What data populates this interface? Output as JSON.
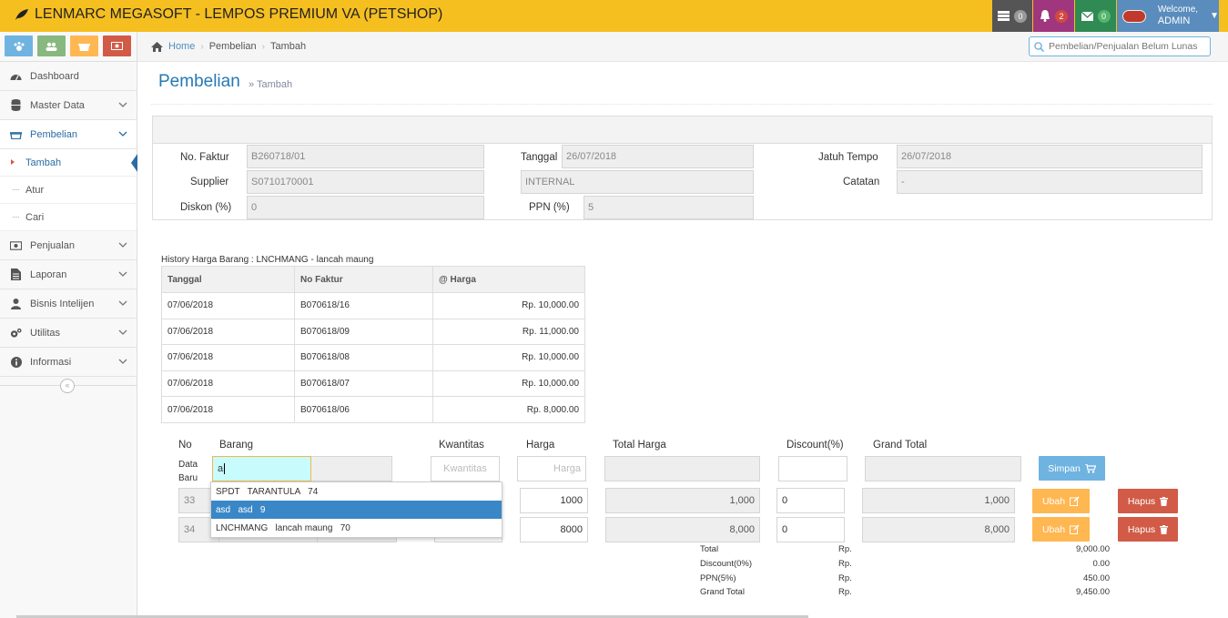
{
  "app": {
    "title": "LENMARC MEGASOFT - LEMPOS PREMIUM VA (PETSHOP)",
    "badges": {
      "tasks": "0",
      "notifications": "2",
      "messages": "0"
    },
    "welcome": "Welcome,",
    "user": "ADMIN"
  },
  "sidebar": {
    "items": [
      {
        "label": "Dashboard"
      },
      {
        "label": "Master Data"
      },
      {
        "label": "Pembelian"
      },
      {
        "label": "Penjualan"
      },
      {
        "label": "Laporan"
      },
      {
        "label": "Bisnis Intelijen"
      },
      {
        "label": "Utilitas"
      },
      {
        "label": "Informasi"
      }
    ],
    "sub_items": [
      {
        "label": "Tambah"
      },
      {
        "label": "Atur"
      },
      {
        "label": "Cari"
      }
    ]
  },
  "breadcrumb": {
    "home": "Home",
    "section": "Pembelian",
    "page": "Tambah"
  },
  "search": {
    "placeholder": "Pembelian/Penjualan Belum Lunas"
  },
  "header": {
    "title": "Pembelian",
    "subtitle": "» Tambah"
  },
  "form": {
    "no_faktur_label": "No. Faktur",
    "no_faktur": "B260718/01",
    "supplier_label": "Supplier",
    "supplier": "S0710170001",
    "diskon_label": "Diskon (%)",
    "diskon": "0",
    "tanggal_label": "Tanggal",
    "tanggal": "26/07/2018",
    "supplier_name": "INTERNAL",
    "ppn_label": "PPN (%)",
    "ppn": "5",
    "jatuh_tempo_label": "Jatuh Tempo",
    "jatuh_tempo": "26/07/2018",
    "catatan_label": "Catatan",
    "catatan": "-"
  },
  "history": {
    "title": "History Harga Barang : LNCHMANG - lancah maung",
    "columns": [
      "Tanggal",
      "No Faktur",
      "@ Harga"
    ],
    "rows": [
      [
        "07/06/2018",
        "B070618/16",
        "Rp. 10,000.00"
      ],
      [
        "07/06/2018",
        "B070618/09",
        "Rp. 11,000.00"
      ],
      [
        "07/06/2018",
        "B070618/08",
        "Rp. 10,000.00"
      ],
      [
        "07/06/2018",
        "B070618/07",
        "Rp. 10,000.00"
      ],
      [
        "07/06/2018",
        "B070618/06",
        "Rp. 8,000.00"
      ]
    ]
  },
  "grid": {
    "headers": {
      "no": "No",
      "barang": "Barang",
      "kwantitas": "Kwantitas",
      "harga": "Harga",
      "total_harga": "Total Harga",
      "discount": "Discount(%)",
      "grand_total": "Grand Total"
    },
    "new_row_label": "Data\nBaru",
    "new_row_label_1": "Data",
    "new_row_label_2": "Baru",
    "barang_input": "a",
    "kwantitas_placeholder": "Kwantitas",
    "harga_placeholder": "Harga",
    "save_button": "Simpan",
    "rows": [
      {
        "no": "33",
        "harga": "1000",
        "total": "1,000",
        "discount": "0",
        "grand": "1,000"
      },
      {
        "no": "34",
        "harga": "8000",
        "total": "8,000",
        "discount": "0",
        "grand": "8,000"
      }
    ],
    "edit_button": "Ubah",
    "delete_button": "Hapus"
  },
  "autocomplete": [
    "SPDT   TARANTULA   74",
    "asd   asd   9",
    "LNCHMANG   lancah maung   70"
  ],
  "totals": {
    "currency": "Rp.",
    "rows": [
      {
        "label": "Total",
        "value": "9,000.00"
      },
      {
        "label": "Discount(0%)",
        "value": "0.00"
      },
      {
        "label": "PPN(5%)",
        "value": "450.00"
      },
      {
        "label": "Grand Total",
        "value": "9,450.00"
      }
    ]
  }
}
